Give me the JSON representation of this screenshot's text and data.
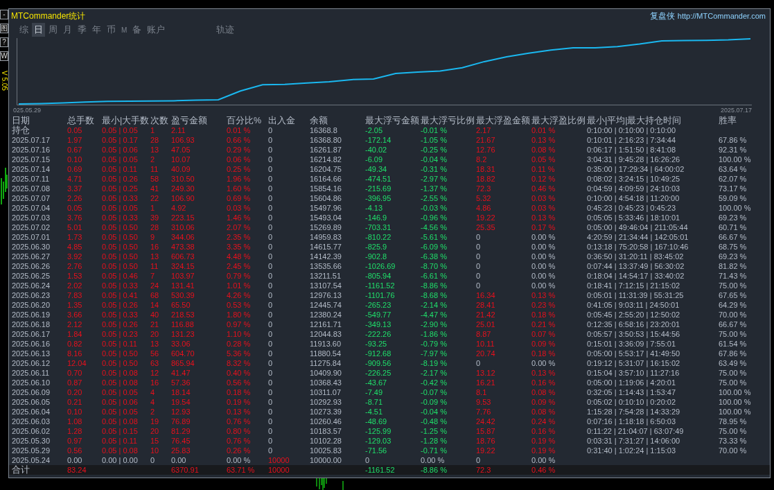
{
  "side_tools": [
    "-",
    "图",
    "?",
    "W"
  ],
  "version": "V 5.05",
  "window": {
    "title": "MTCommander统计",
    "brand": "复盘侠",
    "link": "http://MTCommander.com"
  },
  "tabs": [
    {
      "label": "综",
      "selected": false
    },
    {
      "label": "日",
      "selected": true
    },
    {
      "label": "周",
      "selected": false
    },
    {
      "label": "月",
      "selected": false
    },
    {
      "label": "季",
      "selected": false
    },
    {
      "label": "年",
      "selected": false
    },
    {
      "label": "币",
      "selected": false
    },
    {
      "label": "M",
      "selected": false
    },
    {
      "label": "备",
      "selected": false
    },
    {
      "label": "账户",
      "selected": false
    }
  ],
  "trail_tab": {
    "label": "轨迹",
    "selected": false
  },
  "chart": {
    "x_start_label": "025.05.29",
    "x_end_label": "2025.07.17"
  },
  "columns": [
    "日期",
    "总手数",
    "最小|大手数",
    "次数",
    "盈亏金额",
    "百分比%",
    "出入金",
    "余额",
    "最大浮亏金额",
    "最大浮亏比例",
    "最大浮盈金额",
    "最大浮盈比例",
    "最小|平均|最大持仓时间",
    "胜率"
  ],
  "open_position": {
    "cells": [
      "持仓",
      "0.05",
      "0.05 | 0.05",
      "1",
      "2.11",
      "0.01 %",
      "0",
      "16368.8",
      "-2.05",
      "-0.01 %",
      "2.17",
      "0.01 %",
      "0:10:00 | 0:10:00 | 0:10:00"
    ],
    "no_trades": false,
    "no_float_gain": false,
    "deposit": false
  },
  "rows": [
    {
      "cells": [
        "2025.07.17",
        "1.97",
        "0.05 | 0.17",
        "28",
        "106.93",
        "0.66 %",
        "0",
        "16368.80",
        "-172.14",
        "-1.05 %",
        "21.67",
        "0.13 %",
        "0:10:01 | 2:16:23 | 7:34:44",
        "67.86 %"
      ],
      "no_trades": false,
      "no_float_gain": false,
      "deposit": false
    },
    {
      "cells": [
        "2025.07.16",
        "0.67",
        "0.05 | 0.06",
        "13",
        "47.05",
        "0.29 %",
        "0",
        "16261.87",
        "-40.02",
        "-0.25 %",
        "12.76",
        "0.08 %",
        "0:06:17 | 1:51:50 | 8:41:08",
        "92.31 %"
      ],
      "no_trades": false,
      "no_float_gain": false,
      "deposit": false
    },
    {
      "cells": [
        "2025.07.15",
        "0.10",
        "0.05 | 0.05",
        "2",
        "10.07",
        "0.06 %",
        "0",
        "16214.82",
        "-6.09",
        "-0.04 %",
        "8.2",
        "0.05 %",
        "3:04:31 | 9:45:28 | 16:26:26",
        "100.00 %"
      ],
      "no_trades": false,
      "no_float_gain": false,
      "deposit": false
    },
    {
      "cells": [
        "2025.07.14",
        "0.69",
        "0.05 | 0.11",
        "11",
        "40.09",
        "0.25 %",
        "0",
        "16204.75",
        "-49.34",
        "-0.31 %",
        "18.31",
        "0.11 %",
        "0:35:00 | 17:29:34 | 64:00:02",
        "63.64 %"
      ],
      "no_trades": false,
      "no_float_gain": false,
      "deposit": false
    },
    {
      "cells": [
        "2025.07.11",
        "4.71",
        "0.05 | 0.26",
        "58",
        "310.50",
        "1.96 %",
        "0",
        "16164.66",
        "-474.51",
        "-2.97 %",
        "18.82",
        "0.12 %",
        "0:08:02 | 3:24:15 | 10:49:25",
        "62.07 %"
      ],
      "no_trades": false,
      "no_float_gain": false,
      "deposit": false
    },
    {
      "cells": [
        "2025.07.08",
        "3.37",
        "0.05 | 0.25",
        "41",
        "249.30",
        "1.60 %",
        "0",
        "15854.16",
        "-215.69",
        "-1.37 %",
        "72.3",
        "0.46 %",
        "0:04:59 | 4:09:59 | 24:10:03",
        "73.17 %"
      ],
      "no_trades": false,
      "no_float_gain": false,
      "deposit": false
    },
    {
      "cells": [
        "2025.07.07",
        "2.26",
        "0.05 | 0.33",
        "22",
        "106.90",
        "0.69 %",
        "0",
        "15604.86",
        "-396.95",
        "-2.55 %",
        "5.32",
        "0.03 %",
        "0:10:00 | 4:54:18 | 11:20:00",
        "59.09 %"
      ],
      "no_trades": false,
      "no_float_gain": false,
      "deposit": false
    },
    {
      "cells": [
        "2025.07.04",
        "0.05",
        "0.05 | 0.05",
        "1",
        "4.92",
        "0.03 %",
        "0",
        "15497.96",
        "-4.13",
        "-0.03 %",
        "4.86",
        "0.03 %",
        "0:45:23 | 0:45:23 | 0:45:23",
        "100.00 %"
      ],
      "no_trades": false,
      "no_float_gain": false,
      "deposit": false
    },
    {
      "cells": [
        "2025.07.03",
        "3.76",
        "0.05 | 0.33",
        "39",
        "223.15",
        "1.46 %",
        "0",
        "15493.04",
        "-146.9",
        "-0.96 %",
        "19.22",
        "0.13 %",
        "0:05:05 | 5:33:46 | 18:10:01",
        "69.23 %"
      ],
      "no_trades": false,
      "no_float_gain": false,
      "deposit": false
    },
    {
      "cells": [
        "2025.07.02",
        "5.01",
        "0.05 | 0.50",
        "28",
        "310.06",
        "2.07 %",
        "0",
        "15269.89",
        "-703.31",
        "-4.56 %",
        "25.35",
        "0.17 %",
        "0:05:00 | 49:46:04 | 211:05:44",
        "60.71 %"
      ],
      "no_trades": false,
      "no_float_gain": false,
      "deposit": false
    },
    {
      "cells": [
        "2025.07.01",
        "1.73",
        "0.05 | 0.50",
        "9",
        "344.06",
        "2.35 %",
        "0",
        "14959.83",
        "-810.22",
        "-5.61 %",
        "0",
        "0.00 %",
        "4:20:59 | 21:34:44 | 142:05:01",
        "66.67 %"
      ],
      "no_trades": false,
      "no_float_gain": true,
      "deposit": false
    },
    {
      "cells": [
        "2025.06.30",
        "4.85",
        "0.05 | 0.50",
        "16",
        "473.38",
        "3.35 %",
        "0",
        "14615.77",
        "-825.9",
        "-6.09 %",
        "0",
        "0.00 %",
        "0:13:18 | 75:20:58 | 167:10:46",
        "68.75 %"
      ],
      "no_trades": false,
      "no_float_gain": true,
      "deposit": false
    },
    {
      "cells": [
        "2025.06.27",
        "3.92",
        "0.05 | 0.50",
        "13",
        "606.73",
        "4.48 %",
        "0",
        "14142.39",
        "-902.8",
        "-6.38 %",
        "0",
        "0.00 %",
        "0:36:50 | 31:20:11 | 83:45:02",
        "69.23 %"
      ],
      "no_trades": false,
      "no_float_gain": true,
      "deposit": false
    },
    {
      "cells": [
        "2025.06.26",
        "2.76",
        "0.05 | 0.50",
        "11",
        "324.15",
        "2.45 %",
        "0",
        "13535.66",
        "-1026.69",
        "-8.70 %",
        "0",
        "0.00 %",
        "0:07:44 | 13:37:49 | 56:30:02",
        "81.82 %"
      ],
      "no_trades": false,
      "no_float_gain": true,
      "deposit": false
    },
    {
      "cells": [
        "2025.06.25",
        "1.53",
        "0.05 | 0.46",
        "7",
        "103.97",
        "0.79 %",
        "0",
        "13211.51",
        "-805.94",
        "-6.61 %",
        "0",
        "0.00 %",
        "0:18:04 | 14:54:17 | 33:40:02",
        "71.43 %"
      ],
      "no_trades": false,
      "no_float_gain": true,
      "deposit": false
    },
    {
      "cells": [
        "2025.06.24",
        "2.02",
        "0.05 | 0.33",
        "24",
        "131.41",
        "1.01 %",
        "0",
        "13107.54",
        "-1161.52",
        "-8.86 %",
        "0",
        "0.00 %",
        "0:18:41 | 7:12:15 | 21:15:02",
        "75.00 %"
      ],
      "no_trades": false,
      "no_float_gain": true,
      "deposit": false
    },
    {
      "cells": [
        "2025.06.23",
        "7.83",
        "0.05 | 0.41",
        "68",
        "530.39",
        "4.26 %",
        "0",
        "12976.13",
        "-1101.76",
        "-8.68 %",
        "16.34",
        "0.13 %",
        "0:05:01 | 11:31:39 | 55:31:25",
        "67.65 %"
      ],
      "no_trades": false,
      "no_float_gain": false,
      "deposit": false
    },
    {
      "cells": [
        "2025.06.20",
        "1.35",
        "0.05 | 0.26",
        "14",
        "65.50",
        "0.53 %",
        "0",
        "12445.74",
        "-265.23",
        "-2.14 %",
        "28.41",
        "0.23 %",
        "0:41:05 | 9:03:11 | 24:50:01",
        "64.29 %"
      ],
      "no_trades": false,
      "no_float_gain": false,
      "deposit": false
    },
    {
      "cells": [
        "2025.06.19",
        "3.66",
        "0.05 | 0.33",
        "40",
        "218.53",
        "1.80 %",
        "0",
        "12380.24",
        "-549.77",
        "-4.47 %",
        "21.42",
        "0.18 %",
        "0:05:45 | 2:55:20 | 12:50:02",
        "70.00 %"
      ],
      "no_trades": false,
      "no_float_gain": false,
      "deposit": false
    },
    {
      "cells": [
        "2025.06.18",
        "2.12",
        "0.05 | 0.26",
        "21",
        "116.88",
        "0.97 %",
        "0",
        "12161.71",
        "-349.13",
        "-2.90 %",
        "25.01",
        "0.21 %",
        "0:12:35 | 6:58:16 | 23:20:01",
        "66.67 %"
      ],
      "no_trades": false,
      "no_float_gain": false,
      "deposit": false
    },
    {
      "cells": [
        "2025.06.17",
        "1.84",
        "0.05 | 0.23",
        "20",
        "131.23",
        "1.10 %",
        "0",
        "12044.83",
        "-222.26",
        "-1.86 %",
        "8.87",
        "0.07 %",
        "0:05:57 | 3:50:53 | 15:44:56",
        "75.00 %"
      ],
      "no_trades": false,
      "no_float_gain": false,
      "deposit": false
    },
    {
      "cells": [
        "2025.06.16",
        "0.82",
        "0.05 | 0.11",
        "13",
        "33.06",
        "0.28 %",
        "0",
        "11913.60",
        "-93.25",
        "-0.79 %",
        "10.11",
        "0.09 %",
        "0:15:01 | 3:36:09 | 7:55:01",
        "61.54 %"
      ],
      "no_trades": false,
      "no_float_gain": false,
      "deposit": false
    },
    {
      "cells": [
        "2025.06.13",
        "8.16",
        "0.05 | 0.50",
        "56",
        "604.70",
        "5.36 %",
        "0",
        "11880.54",
        "-912.68",
        "-7.97 %",
        "20.74",
        "0.18 %",
        "0:05:00 | 5:53:17 | 41:49:50",
        "67.86 %"
      ],
      "no_trades": false,
      "no_float_gain": false,
      "deposit": false
    },
    {
      "cells": [
        "2025.06.12",
        "12.04",
        "0.05 | 0.50",
        "63",
        "865.94",
        "8.32 %",
        "0",
        "11275.84",
        "-909.56",
        "-8.19 %",
        "0",
        "0.00 %",
        "0:19:12 | 5:31:07 | 16:15:02",
        "63.49 %"
      ],
      "no_trades": false,
      "no_float_gain": true,
      "deposit": false
    },
    {
      "cells": [
        "2025.06.11",
        "0.70",
        "0.05 | 0.08",
        "12",
        "41.47",
        "0.40 %",
        "0",
        "10409.90",
        "-226.25",
        "-2.17 %",
        "13.12",
        "0.13 %",
        "0:15:04 | 3:57:10 | 11:27:16",
        "75.00 %"
      ],
      "no_trades": false,
      "no_float_gain": false,
      "deposit": false
    },
    {
      "cells": [
        "2025.06.10",
        "0.87",
        "0.05 | 0.08",
        "16",
        "57.36",
        "0.56 %",
        "0",
        "10368.43",
        "-43.67",
        "-0.42 %",
        "16.21",
        "0.16 %",
        "0:05:00 | 1:19:06 | 4:20:01",
        "75.00 %"
      ],
      "no_trades": false,
      "no_float_gain": false,
      "deposit": false
    },
    {
      "cells": [
        "2025.06.09",
        "0.20",
        "0.05 | 0.05",
        "4",
        "18.14",
        "0.18 %",
        "0",
        "10311.07",
        "-7.49",
        "-0.07 %",
        "8.1",
        "0.08 %",
        "0:32:05 | 1:14:43 | 1:53:47",
        "100.00 %"
      ],
      "no_trades": false,
      "no_float_gain": false,
      "deposit": false
    },
    {
      "cells": [
        "2025.06.05",
        "0.21",
        "0.05 | 0.06",
        "4",
        "19.54",
        "0.19 %",
        "0",
        "10292.93",
        "-8.71",
        "-0.09 %",
        "9.53",
        "0.09 %",
        "0:05:02 | 0:10:10 | 0:20:02",
        "100.00 %"
      ],
      "no_trades": false,
      "no_float_gain": false,
      "deposit": false
    },
    {
      "cells": [
        "2025.06.04",
        "0.10",
        "0.05 | 0.05",
        "2",
        "12.93",
        "0.13 %",
        "0",
        "10273.39",
        "-4.51",
        "-0.04 %",
        "7.76",
        "0.08 %",
        "1:15:28 | 7:54:28 | 14:33:29",
        "100.00 %"
      ],
      "no_trades": false,
      "no_float_gain": false,
      "deposit": false
    },
    {
      "cells": [
        "2025.06.03",
        "1.08",
        "0.05 | 0.08",
        "19",
        "76.89",
        "0.76 %",
        "0",
        "10260.46",
        "-48.69",
        "-0.48 %",
        "24.42",
        "0.24 %",
        "0:07:16 | 1:18:18 | 6:50:03",
        "78.95 %"
      ],
      "no_trades": false,
      "no_float_gain": false,
      "deposit": false
    },
    {
      "cells": [
        "2025.06.02",
        "1.28",
        "0.05 | 0.15",
        "20",
        "81.29",
        "0.80 %",
        "0",
        "10183.57",
        "-125.99",
        "-1.25 %",
        "15.87",
        "0.16 %",
        "0:11:22 | 21:04:07 | 63:07:49",
        "75.00 %"
      ],
      "no_trades": false,
      "no_float_gain": false,
      "deposit": false
    },
    {
      "cells": [
        "2025.05.30",
        "0.97",
        "0.05 | 0.11",
        "15",
        "76.45",
        "0.76 %",
        "0",
        "10102.28",
        "-129.03",
        "-1.28 %",
        "18.76",
        "0.19 %",
        "0:03:31 | 7:31:27 | 14:06:00",
        "73.33 %"
      ],
      "no_trades": false,
      "no_float_gain": false,
      "deposit": false
    },
    {
      "cells": [
        "2025.05.29",
        "0.56",
        "0.05 | 0.08",
        "10",
        "25.83",
        "0.26 %",
        "0",
        "10025.83",
        "-71.56",
        "-0.71 %",
        "19.22",
        "0.19 %",
        "0:31:40 | 1:02:24 | 1:15:03",
        "70.00 %"
      ],
      "no_trades": false,
      "no_float_gain": false,
      "deposit": false
    },
    {
      "cells": [
        "2025.05.24",
        "0.00",
        "0.00 | 0.00",
        "0",
        "0.00",
        "0.00 %",
        "10000",
        "10000.00",
        "0",
        "0.00 %",
        "0",
        "0.00 %"
      ],
      "no_trades": true,
      "no_float_gain": true,
      "deposit": true
    }
  ],
  "total": {
    "label": "合计",
    "lots": "83.24",
    "pnl": "6370.91",
    "pct": "63.71 %",
    "cash": "10000",
    "float_loss": "-1161.52",
    "float_loss_pct": "-8.86 %",
    "float_gain": "72.3",
    "float_gain_pct": "0.46 %"
  }
}
